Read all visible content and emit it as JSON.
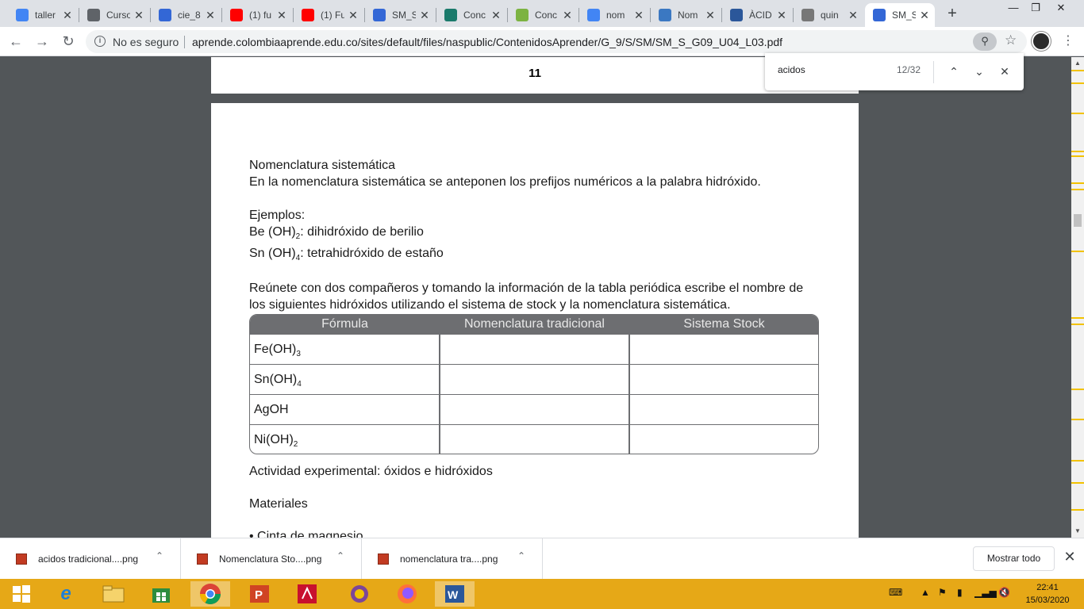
{
  "browser": {
    "tabs": [
      {
        "label": "taller",
        "icon": "google-icon",
        "color": "#4285f4"
      },
      {
        "label": "Curso",
        "icon": "globe-icon",
        "color": "#5f6368"
      },
      {
        "label": "cie_8",
        "icon": "doc-icon",
        "color": "#3367d6"
      },
      {
        "label": "(1) fu",
        "icon": "youtube-icon",
        "color": "#ff0000"
      },
      {
        "label": "(1) Fu",
        "icon": "youtube-icon",
        "color": "#ff0000"
      },
      {
        "label": "SM_S",
        "icon": "doc-icon",
        "color": "#3367d6"
      },
      {
        "label": "Conc",
        "icon": "book-icon",
        "color": "#1a7a6b"
      },
      {
        "label": "Conc",
        "icon": "chart-icon",
        "color": "#7cb342"
      },
      {
        "label": "nom",
        "icon": "google-icon",
        "color": "#4285f4"
      },
      {
        "label": "Nom",
        "icon": "circle-icon",
        "color": "#3b78c2"
      },
      {
        "label": "ÀCID",
        "icon": "word-icon",
        "color": "#2b579a"
      },
      {
        "label": "quin",
        "icon": "gear-icon",
        "color": "#777777"
      },
      {
        "label": "SM_S",
        "icon": "doc-icon",
        "color": "#3367d6",
        "active": true
      }
    ],
    "security_label": "No es seguro",
    "url": "aprende.colombiaaprende.edu.co/sites/default/files/naspublic/ContenidosAprender/G_9/S/SM/SM_S_G09_U04_L03.pdf"
  },
  "find": {
    "query": "acidos",
    "count": "12/32"
  },
  "pdf": {
    "page_number": "11",
    "section_title": "Nomenclatura sistemática",
    "section_text": "En la nomenclatura sistemática se anteponen los prefijos numéricos a la palabra hidróxido.",
    "examples_title": "Ejemplos:",
    "examples": [
      {
        "pre": "Be (OH)",
        "sub": "2",
        "post": ": dihidróxido de berilio"
      },
      {
        "pre": "Sn (OH)",
        "sub": "4",
        "post": ": tetrahidróxido de estaño"
      }
    ],
    "instruction": "Reúnete con dos compañeros y tomando la información de la tabla periódica escribe el nombre de los siguientes hidróxidos utilizando el sistema de stock y la nomenclatura sistemática.",
    "table": {
      "headers": [
        "Fórmula",
        "Nomenclatura tradicional",
        "Sistema Stock"
      ],
      "rows": [
        {
          "pre": "Fe(OH)",
          "sub": "3"
        },
        {
          "pre": "Sn(OH)",
          "sub": "4"
        },
        {
          "pre": "AgOH",
          "sub": ""
        },
        {
          "pre": "Ni(OH)",
          "sub": "2"
        }
      ]
    },
    "activity_title": "Actividad experimental: óxidos e hidróxidos",
    "materials_title": "Materiales",
    "material_item": "• Cinta de magnesio"
  },
  "downloads": {
    "items": [
      "acidos tradicional....png",
      "Nomenclatura Sto....png",
      "nomenclatura tra....png"
    ],
    "show_all": "Mostrar todo"
  },
  "taskbar": {
    "time": "22:41",
    "date": "15/03/2020"
  }
}
